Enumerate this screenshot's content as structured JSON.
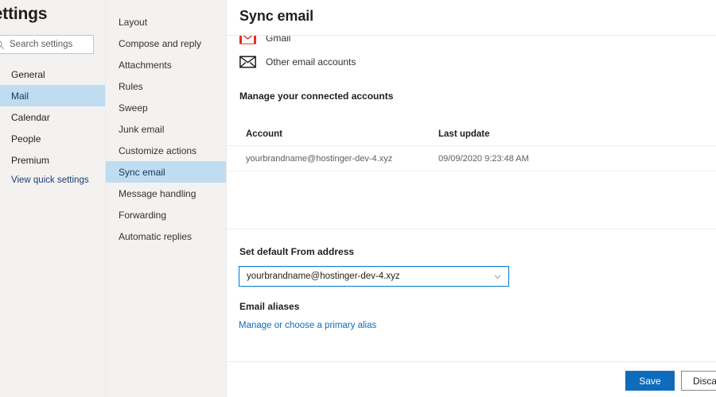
{
  "sidebar": {
    "title": "Settings",
    "search": {
      "placeholder": "Search settings",
      "value": "",
      "icon": "search-icon"
    },
    "items": [
      {
        "label": "General",
        "selected": false
      },
      {
        "label": "Mail",
        "selected": true
      },
      {
        "label": "Calendar",
        "selected": false
      },
      {
        "label": "People",
        "selected": false
      },
      {
        "label": "Premium",
        "selected": false
      }
    ],
    "quick_settings_link": "View quick settings"
  },
  "subnav": {
    "items": [
      {
        "label": "Layout",
        "selected": false
      },
      {
        "label": "Compose and reply",
        "selected": false
      },
      {
        "label": "Attachments",
        "selected": false
      },
      {
        "label": "Rules",
        "selected": false
      },
      {
        "label": "Sweep",
        "selected": false
      },
      {
        "label": "Junk email",
        "selected": false
      },
      {
        "label": "Customize actions",
        "selected": false
      },
      {
        "label": "Sync email",
        "selected": true
      },
      {
        "label": "Message handling",
        "selected": false
      },
      {
        "label": "Forwarding",
        "selected": false
      },
      {
        "label": "Automatic replies",
        "selected": false
      }
    ]
  },
  "main": {
    "title": "Sync email",
    "providers": [
      {
        "label": "Gmail",
        "icon": "gmail-icon"
      },
      {
        "label": "Other email accounts",
        "icon": "envelope-icon"
      }
    ],
    "manage_heading": "Manage your connected accounts",
    "table": {
      "columns": [
        "Account",
        "Last update"
      ],
      "rows": [
        {
          "account": "yourbrandname@hostinger-dev-4.xyz",
          "last_update": "09/09/2020 9:23:48 AM"
        }
      ]
    },
    "default_from": {
      "heading": "Set default From address",
      "selected": "yourbrandname@hostinger-dev-4.xyz",
      "options": [
        "yourbrandname@hostinger-dev-4.xyz"
      ],
      "icon": "chevron-down-icon"
    },
    "aliases": {
      "heading": "Email aliases",
      "link": "Manage or choose a primary alias"
    }
  },
  "footer": {
    "save_label": "Save",
    "discard_label": "Discard"
  },
  "colors": {
    "accent": "#0f6cbd",
    "selection": "#bfdcf0",
    "panel": "#f3f2f1",
    "link": "#0f6cbd",
    "focus_border": "#0078d4",
    "gmail_red": "#d93025"
  }
}
